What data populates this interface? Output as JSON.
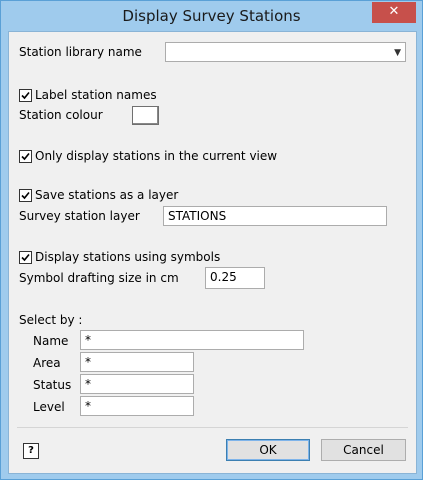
{
  "window": {
    "title": "Display Survey Stations",
    "close_glyph": "✕"
  },
  "station_library": {
    "label": "Station library name",
    "value": ""
  },
  "label_station_names": {
    "label": "Label station names",
    "checked": true
  },
  "station_colour": {
    "label": "Station colour",
    "color": "#ffffff"
  },
  "only_current_view": {
    "label": "Only display stations in the current view",
    "checked": true
  },
  "save_as_layer": {
    "label": "Save stations as a layer",
    "checked": true
  },
  "survey_station_layer": {
    "label": "Survey station layer",
    "value": "STATIONS"
  },
  "display_symbols": {
    "label": "Display stations using symbols",
    "checked": true
  },
  "symbol_size": {
    "label": "Symbol drafting size in cm",
    "value": "0.25"
  },
  "select_by": {
    "heading": "Select by :",
    "name": {
      "label": "Name",
      "value": "*"
    },
    "area": {
      "label": "Area",
      "value": "*"
    },
    "status": {
      "label": "Status",
      "value": "*"
    },
    "level": {
      "label": "Level",
      "value": "*"
    }
  },
  "buttons": {
    "ok": "OK",
    "cancel": "Cancel",
    "help_glyph": "?"
  }
}
